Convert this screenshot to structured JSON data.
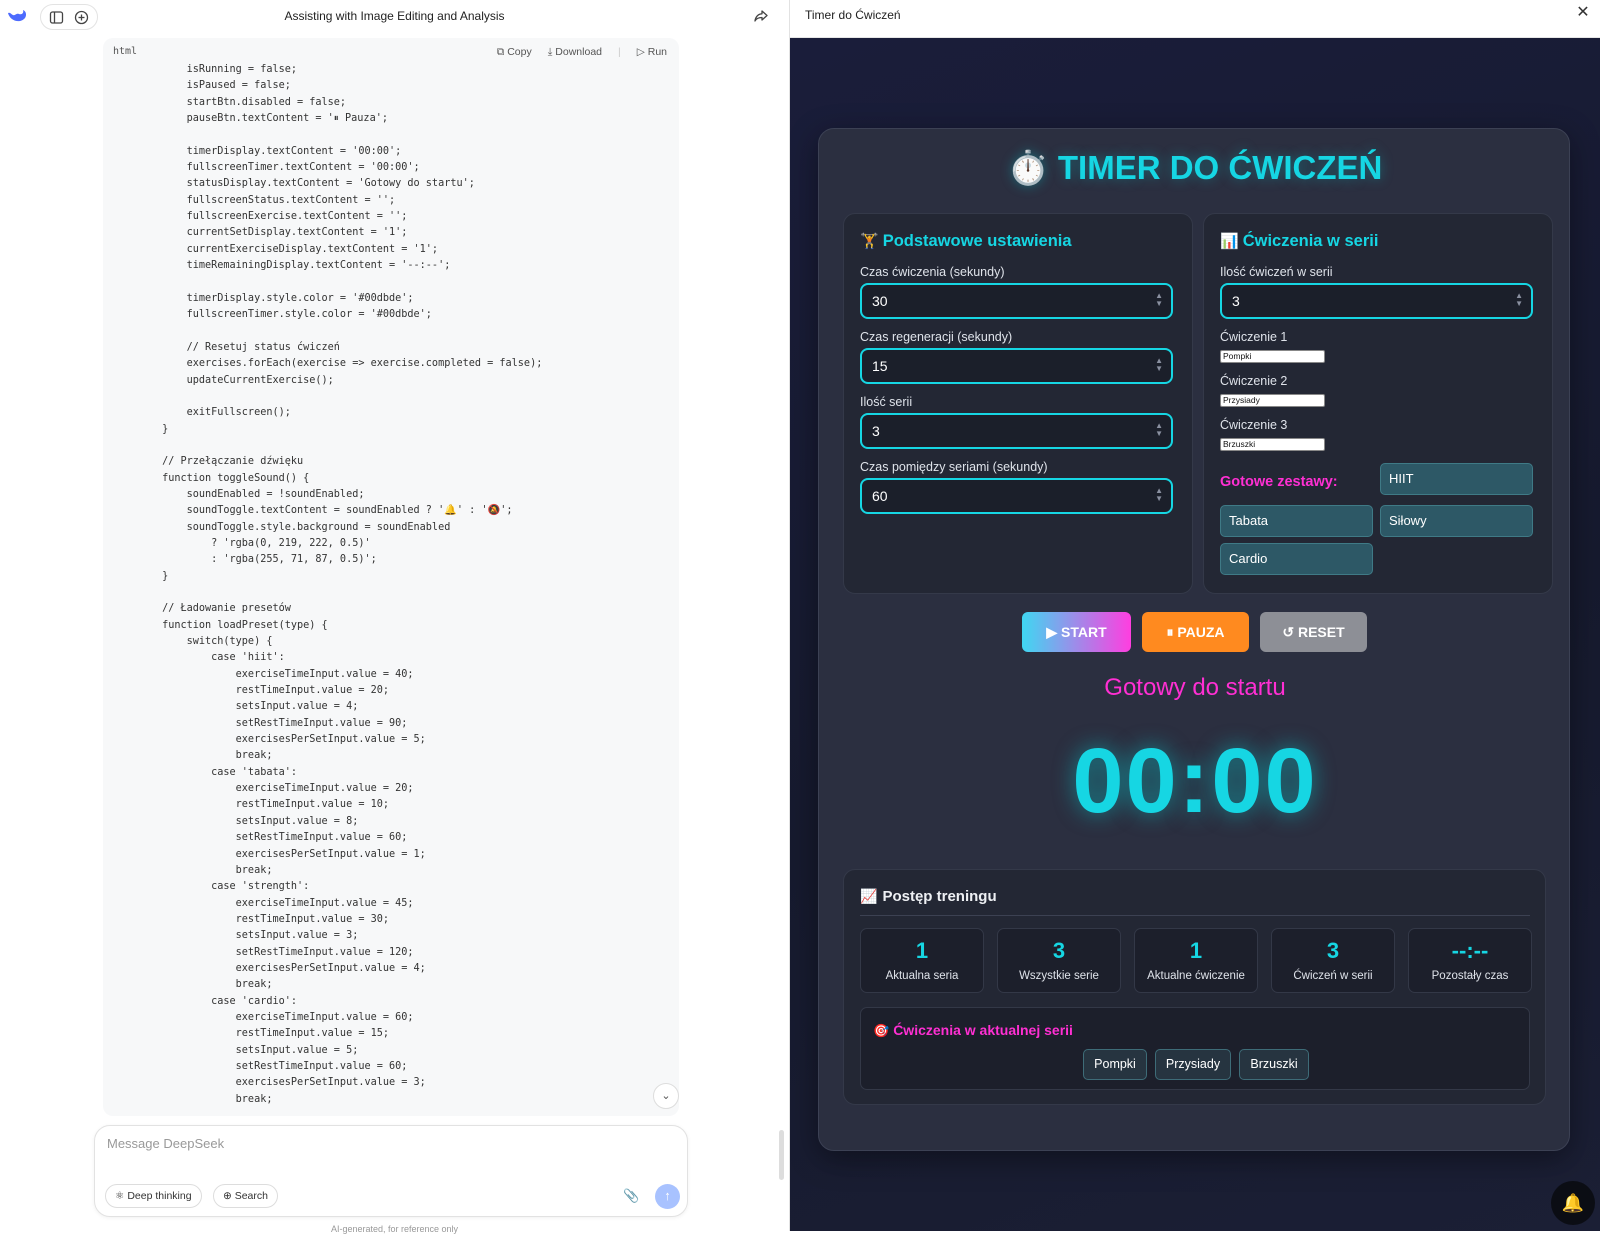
{
  "chat": {
    "title": "Assisting with Image Editing and Analysis",
    "code_block": {
      "language": "html",
      "copy_label": "Copy",
      "download_label": "Download",
      "run_label": "Run",
      "code": "            isRunning = false;\n            isPaused = false;\n            startBtn.disabled = false;\n            pauseBtn.textContent = '⏸ Pauza';\n\n            timerDisplay.textContent = '00:00';\n            fullscreenTimer.textContent = '00:00';\n            statusDisplay.textContent = 'Gotowy do startu';\n            fullscreenStatus.textContent = '';\n            fullscreenExercise.textContent = '';\n            currentSetDisplay.textContent = '1';\n            currentExerciseDisplay.textContent = '1';\n            timeRemainingDisplay.textContent = '--:--';\n\n            timerDisplay.style.color = '#00dbde';\n            fullscreenTimer.style.color = '#00dbde';\n\n            // Resetuj status ćwiczeń\n            exercises.forEach(exercise => exercise.completed = false);\n            updateCurrentExercise();\n\n            exitFullscreen();\n        }\n\n        // Przełączanie dźwięku\n        function toggleSound() {\n            soundEnabled = !soundEnabled;\n            soundToggle.textContent = soundEnabled ? '🔔' : '🔕';\n            soundToggle.style.background = soundEnabled\n                ? 'rgba(0, 219, 222, 0.5)'\n                : 'rgba(255, 71, 87, 0.5)';\n        }\n\n        // Ładowanie presetów\n        function loadPreset(type) {\n            switch(type) {\n                case 'hiit':\n                    exerciseTimeInput.value = 40;\n                    restTimeInput.value = 20;\n                    setsInput.value = 4;\n                    setRestTimeInput.value = 90;\n                    exercisesPerSetInput.value = 5;\n                    break;\n                case 'tabata':\n                    exerciseTimeInput.value = 20;\n                    restTimeInput.value = 10;\n                    setsInput.value = 8;\n                    setRestTimeInput.value = 60;\n                    exercisesPerSetInput.value = 1;\n                    break;\n                case 'strength':\n                    exerciseTimeInput.value = 45;\n                    restTimeInput.value = 30;\n                    setsInput.value = 3;\n                    setRestTimeInput.value = 120;\n                    exercisesPerSetInput.value = 4;\n                    break;\n                case 'cardio':\n                    exerciseTimeInput.value = 60;\n                    restTimeInput.value = 15;\n                    setsInput.value = 5;\n                    setRestTimeInput.value = 60;\n                    exercisesPerSetInput.value = 3;\n                    break;"
    },
    "composer": {
      "placeholder": "Message DeepSeek",
      "deep_thinking_label": "Deep thinking",
      "search_label": "Search"
    },
    "disclaimer": "AI-generated, for reference only"
  },
  "preview": {
    "title": "Timer do Ćwiczeń",
    "app": {
      "title_icon": "⏱️",
      "title": "TIMER DO ĆWICZEŃ",
      "basic": {
        "icon": "🏋️",
        "heading": "Podstawowe ustawienia",
        "fields": [
          {
            "label": "Czas ćwiczenia (sekundy)",
            "value": "30"
          },
          {
            "label": "Czas regeneracji (sekundy)",
            "value": "15"
          },
          {
            "label": "Ilość serii",
            "value": "3"
          },
          {
            "label": "Czas pomiędzy seriami (sekundy)",
            "value": "60"
          }
        ]
      },
      "series": {
        "icon": "📊",
        "heading": "Ćwiczenia w serii",
        "count_label": "Ilość ćwiczeń w serii",
        "count_value": "3",
        "exercises": [
          {
            "label": "Ćwiczenie 1",
            "value": "Pompki"
          },
          {
            "label": "Ćwiczenie 2",
            "value": "Przysiady"
          },
          {
            "label": "Ćwiczenie 3",
            "value": "Brzuszki"
          }
        ],
        "presets_label": "Gotowe zestawy:",
        "presets": [
          "HIIT",
          "Tabata",
          "Siłowy",
          "Cardio"
        ]
      },
      "controls": {
        "start": "▶ START",
        "pause": "⏸ PAUZA",
        "reset": "↺ RESET"
      },
      "status": "Gotowy do startu",
      "timer": "00:00",
      "progress": {
        "icon": "📈",
        "heading": "Postęp treningu",
        "stats": [
          {
            "value": "1",
            "label": "Aktualna seria"
          },
          {
            "value": "3",
            "label": "Wszystkie serie"
          },
          {
            "value": "1",
            "label": "Aktualne ćwiczenie"
          },
          {
            "value": "3",
            "label": "Ćwiczeń w serii"
          },
          {
            "value": "--:--",
            "label": "Pozostały czas"
          }
        ],
        "current_series": {
          "icon": "🎯",
          "heading": "Ćwiczenia w aktualnej serii",
          "items": [
            "Pompki",
            "Przysiady",
            "Brzuszki"
          ]
        }
      },
      "sound_icon": "🔔"
    }
  },
  "colors": {
    "accent_cyan": "#16d6e3",
    "accent_magenta": "#ff2fd3",
    "pause_orange": "#ff8a1f",
    "reset_gray": "#8d8f96"
  }
}
